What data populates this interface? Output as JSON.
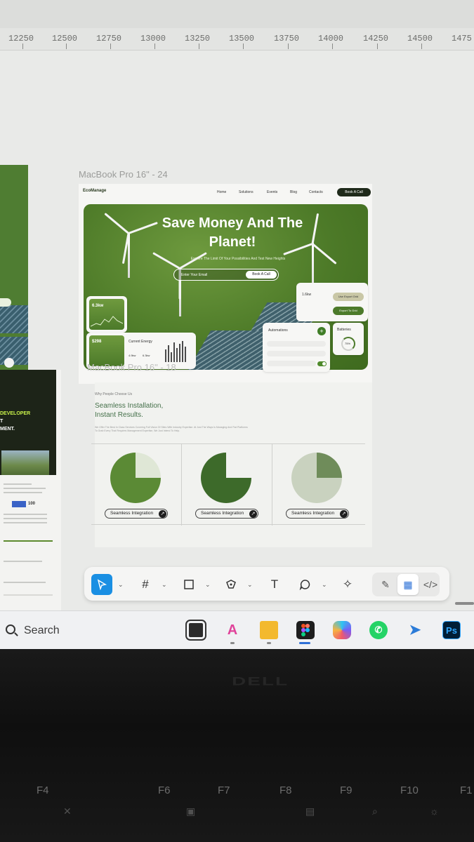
{
  "ruler": {
    "labels": [
      "12250",
      "12500",
      "12750",
      "13000",
      "13250",
      "13500",
      "13750",
      "14000",
      "14250",
      "14500",
      "1475"
    ]
  },
  "frames": {
    "main_label": "MacBook Pro 16\" - 24",
    "second_label": "MacBook Pro 16\" - 18"
  },
  "design": {
    "logo": "EcoManage",
    "nav_links": [
      "Home",
      "Solutions",
      "Events",
      "Blog",
      "Contacts"
    ],
    "nav_cta": "Book A Call",
    "hero_title_line1": "Save Money And The",
    "hero_title_line2": "Planet!",
    "hero_subtitle": "Explore The Limit Of Your Possibilities And Test New Heights",
    "email_placeholder": "Enter Your Email",
    "email_button": "Book A Call",
    "card_energy_value": "6.3kw",
    "card_money_value": "$298",
    "current_energy_label": "Current Energy",
    "current_energy_vals": [
      "4.9kw",
      "6.3kw"
    ],
    "card_top_right_value": "1.6kw",
    "pill_use_grid": "Use Export Grid",
    "pill_export_grid": "Export To Grid",
    "automations_label": "Automations",
    "batteries_label": "Batteries",
    "battery_percent": "75%",
    "add_symbol": "+"
  },
  "section2": {
    "eyebrow": "Why People Choose Us",
    "title_line1": "Seamless Installation,",
    "title_line2": "Instant Results.",
    "description": "We Offer The Best In Class Services Covering Full Vision Of Sites With Industry Expertise. At Just The Ways Is Managing And Flat Platforms To Grab Every That Requires Management Expertise, We Just Intend To Help.",
    "cards": [
      {
        "label": "Seamless Integration"
      },
      {
        "label": "Seamless Integration"
      },
      {
        "label": "Seamless Integration"
      }
    ]
  },
  "left_panel": {
    "heading_line1": "DEVELOPER",
    "heading_line2": "T",
    "heading_line3": "MENT.",
    "value": "100"
  },
  "toolbar": {
    "tools": [
      "move-tool",
      "frame-tool",
      "shape-tool",
      "pen-tool",
      "text-tool",
      "comment-tool",
      "actions-tool"
    ],
    "text_tool_glyph": "T",
    "frame_tool_glyph": "#",
    "dev_mode_glyph": "</>"
  },
  "taskbar": {
    "search_label": "Search",
    "apps": [
      "file-explorer-app",
      "copilot-ai-app",
      "folder-app",
      "figma-app",
      "copilot-app",
      "whatsapp-app",
      "nearby-share-app",
      "photoshop-app"
    ],
    "photoshop_label": "Ps"
  },
  "keyboard": {
    "brand": "DELL",
    "keys": [
      "F4",
      "F6",
      "F7",
      "F8",
      "F9",
      "F10",
      "F1"
    ]
  },
  "colors": {
    "brand_green": "#4d7a28",
    "figma_blue": "#1a8fe3",
    "dark": "#1f2a1a"
  }
}
